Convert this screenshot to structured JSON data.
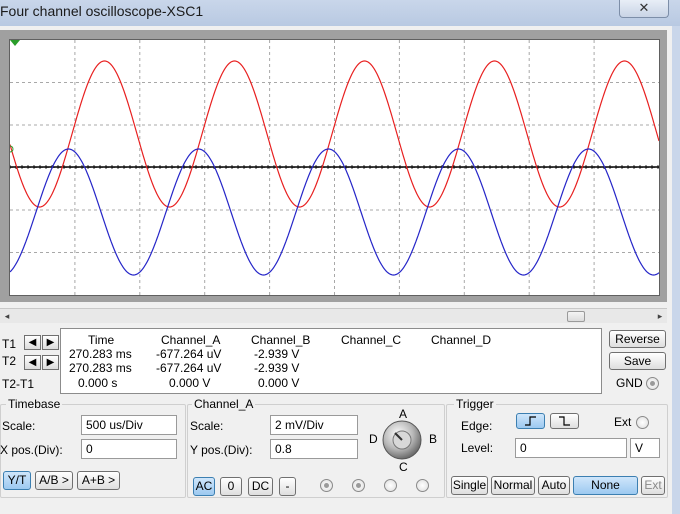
{
  "window": {
    "title": "Four channel oscilloscope-XSC1",
    "close_glyph": "✕"
  },
  "screen": {
    "trace_colors": {
      "red": "#e82020",
      "blue": "#2626c8",
      "black": "#000000",
      "grid": "#a8a8a8"
    }
  },
  "cursors": {
    "t1_label": "T1",
    "t2_label": "T2",
    "t2t1_label": "T2-T1",
    "headers": [
      "Time",
      "Channel_A",
      "Channel_B",
      "Channel_C",
      "Channel_D"
    ],
    "rows": [
      [
        "270.283 ms",
        "-677.264 uV",
        "-2.939 V",
        "",
        ""
      ],
      [
        "270.283 ms",
        "-677.264 uV",
        "-2.939 V",
        "",
        ""
      ],
      [
        "0.000 s",
        "0.000 V",
        "0.000 V",
        "",
        ""
      ]
    ]
  },
  "side_buttons": {
    "reverse": "Reverse",
    "save": "Save",
    "gnd": "GND"
  },
  "timebase": {
    "title": "Timebase",
    "scale_label": "Scale:",
    "scale_value": "500 us/Div",
    "xpos_label": "X pos.(Div):",
    "xpos_value": "0",
    "modes": [
      "Y/T",
      "A/B >",
      "A+B >"
    ]
  },
  "channel": {
    "title": "Channel_A",
    "scale_label": "Scale:",
    "scale_value": "2 mV/Div",
    "ypos_label": "Y pos.(Div):",
    "ypos_value": "0.8",
    "coupling": [
      "AC",
      "0",
      "DC",
      "-"
    ],
    "knob_labels": [
      "A",
      "B",
      "C",
      "D"
    ]
  },
  "trigger": {
    "title": "Trigger",
    "edge_label": "Edge:",
    "level_label": "Level:",
    "level_value": "0",
    "level_unit": "V",
    "ext_label": "Ext",
    "modes": [
      "Single",
      "Normal",
      "Auto",
      "None"
    ],
    "ext_button": "Ext"
  }
}
